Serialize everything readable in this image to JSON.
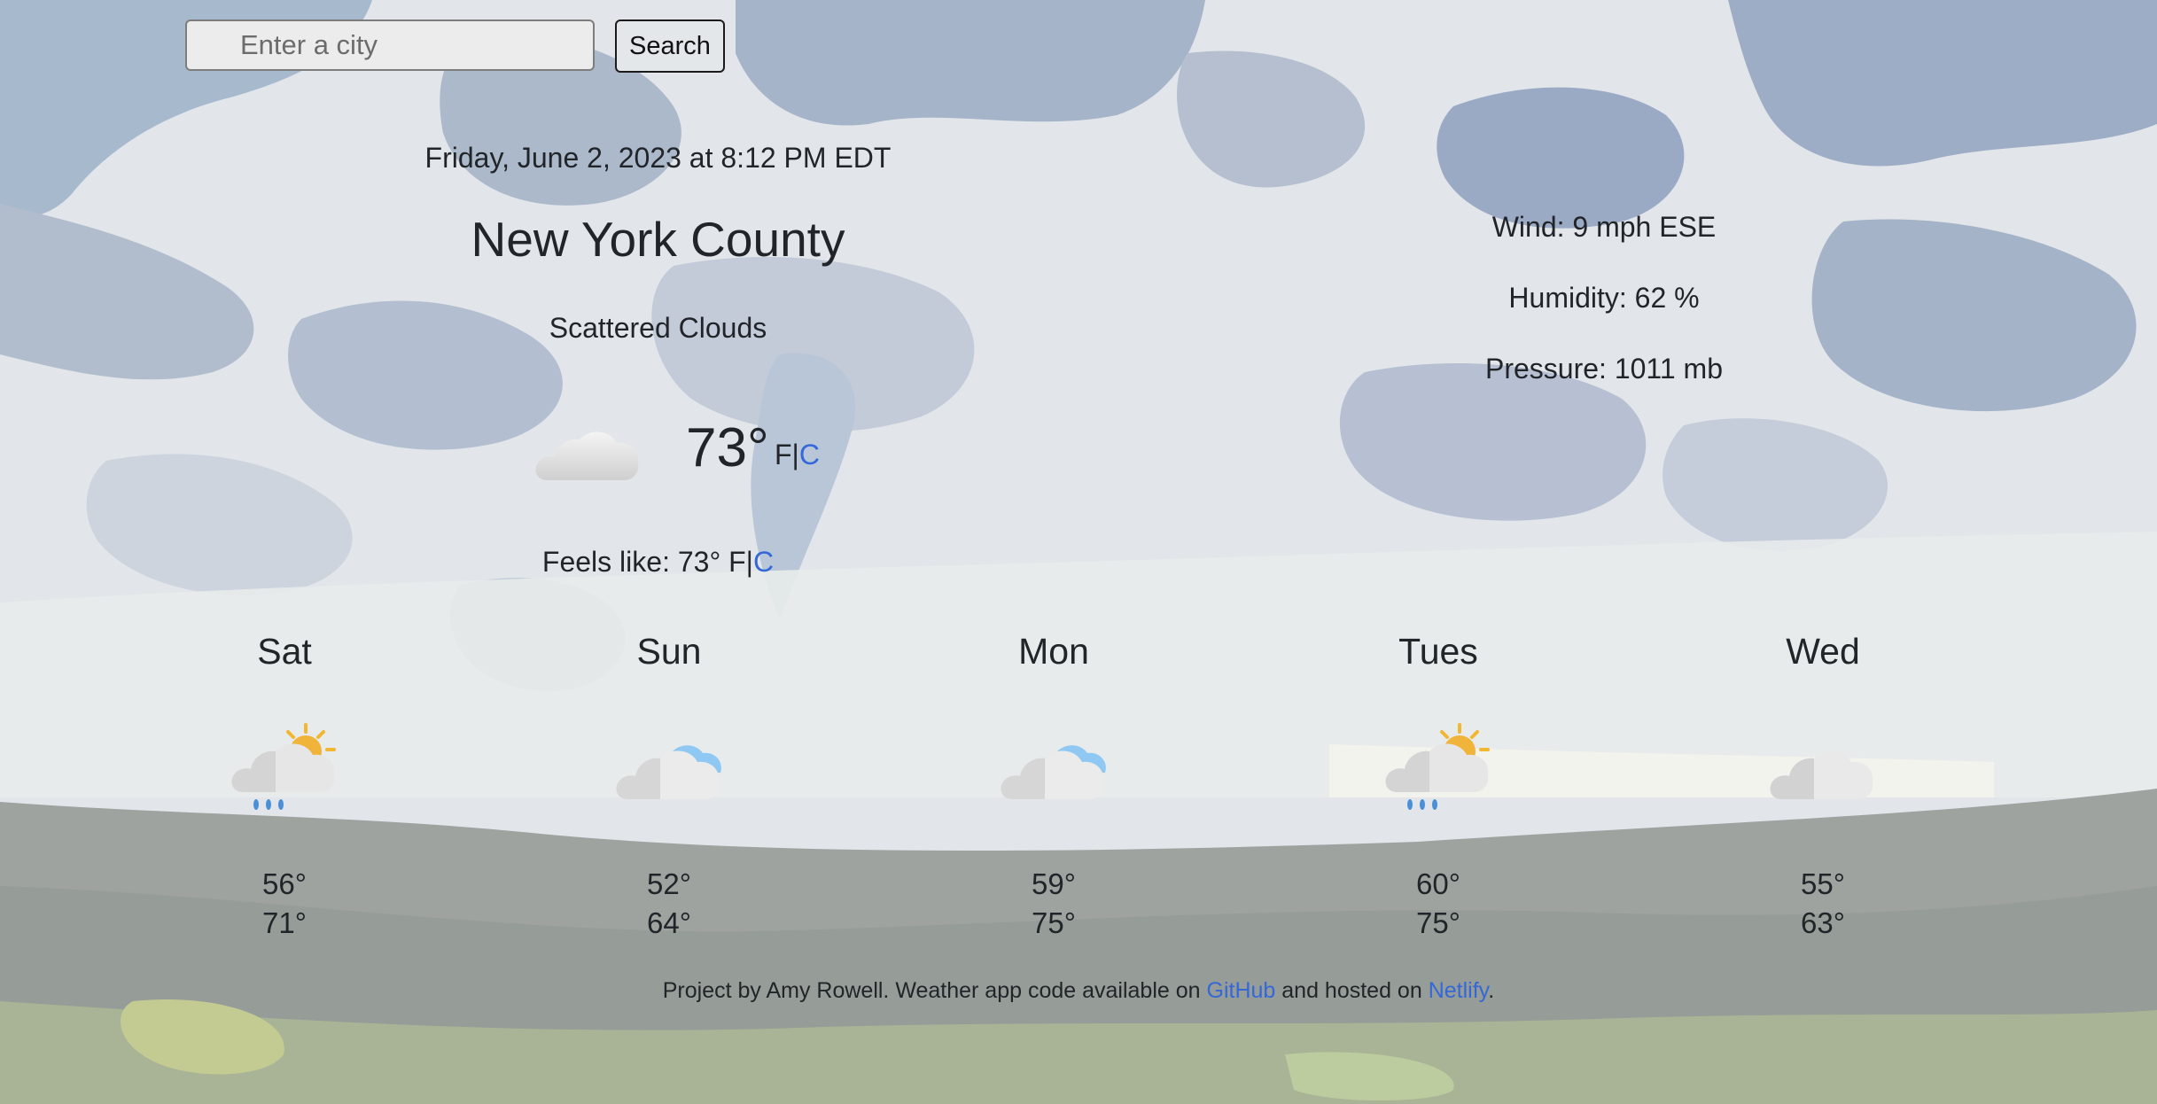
{
  "search": {
    "placeholder": "Enter a city",
    "button_label": "Search"
  },
  "current": {
    "datetime": "Friday, June 2, 2023 at 8:12 PM EDT",
    "city": "New York County",
    "description": "Scattered Clouds",
    "icon": "cloud-icon",
    "temperature": "73°",
    "unit_f": "F",
    "unit_separator": "|",
    "unit_c": "C",
    "feels_like_label": "Feels like: 73° F|",
    "feels_like_unit_c": "C"
  },
  "details": {
    "wind": "Wind: 9 mph ESE",
    "humidity": "Humidity: 62 %",
    "pressure": "Pressure: 1011 mb"
  },
  "forecast": [
    {
      "day": "Sat",
      "icon": "sun-cloud-rain-icon",
      "low": "56°",
      "high": "71°"
    },
    {
      "day": "Sun",
      "icon": "blue-cloud-icon",
      "low": "52°",
      "high": "64°"
    },
    {
      "day": "Mon",
      "icon": "blue-cloud-icon",
      "low": "59°",
      "high": "75°"
    },
    {
      "day": "Tues",
      "icon": "sun-cloud-rain-icon",
      "low": "60°",
      "high": "75°"
    },
    {
      "day": "Wed",
      "icon": "cloud-icon",
      "low": "55°",
      "high": "63°"
    }
  ],
  "footer": {
    "text_1": "Project by Amy Rowell. Weather app code available on ",
    "link_github": "GitHub",
    "text_2": " and hosted on ",
    "link_netlify": "Netlify",
    "text_3": "."
  },
  "colors": {
    "text": "#212529",
    "link": "#3468d8",
    "sky": "#c9d3e1",
    "ground": "#999f99"
  }
}
